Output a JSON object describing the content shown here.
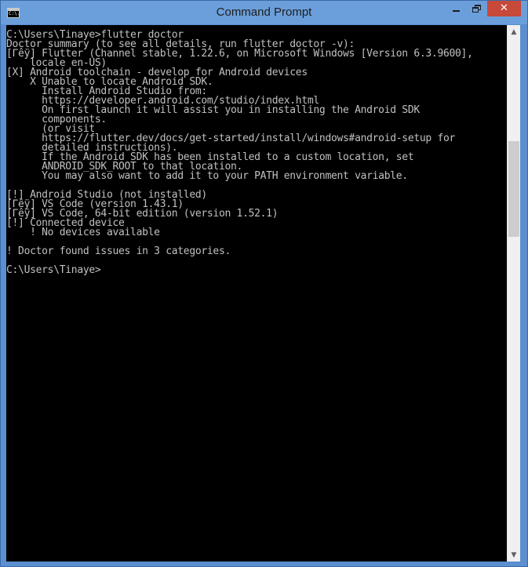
{
  "window": {
    "title": "Command Prompt",
    "icon_label": "C:\\.",
    "controls": {
      "minimize": "minimize-icon",
      "maximize": "restore-icon",
      "close_glyph": "✕"
    }
  },
  "console": {
    "lines": [
      "C:\\Users\\Tinaye>flutter doctor",
      "Doctor summary (to see all details, run flutter doctor -v):",
      "[Γêÿ] Flutter (Channel stable, 1.22.6, on Microsoft Windows [Version 6.3.9600],",
      "    locale en-US)",
      "[X] Android toolchain - develop for Android devices",
      "    X Unable to locate Android SDK.",
      "      Install Android Studio from:",
      "      https://developer.android.com/studio/index.html",
      "      On first launch it will assist you in installing the Android SDK",
      "      components.",
      "      (or visit",
      "      https://flutter.dev/docs/get-started/install/windows#android-setup for",
      "      detailed instructions).",
      "      If the Android SDK has been installed to a custom location, set",
      "      ANDROID_SDK_ROOT to that location.",
      "      You may also want to add it to your PATH environment variable.",
      "",
      "[!] Android Studio (not installed)",
      "[Γêÿ] VS Code (version 1.43.1)",
      "[Γêÿ] VS Code, 64-bit edition (version 1.52.1)",
      "[!] Connected device",
      "    ! No devices available",
      "",
      "! Doctor found issues in 3 categories.",
      "",
      "C:\\Users\\Tinaye>"
    ]
  },
  "scrollbar": {
    "up_glyph": "▲",
    "down_glyph": "▼"
  }
}
